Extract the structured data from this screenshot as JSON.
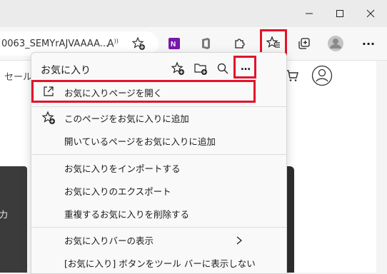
{
  "browser": {
    "address_text": "0063_SEMYrAJVAAAA...",
    "read_aloud_label": "A̅"
  },
  "page": {
    "left_text": "セール",
    "partial_text": "カ"
  },
  "favorites_panel": {
    "title": "お気に入り",
    "more_label": "…",
    "items": [
      {
        "label": "お気に入りページを開く"
      },
      {
        "label": "このページをお気に入りに追加"
      },
      {
        "label": "開いているページをお気に入りに追加"
      },
      {
        "label": "お気に入りをインポートする"
      },
      {
        "label": "お気に入りのエクスポート"
      },
      {
        "label": "重複するお気に入りを削除する"
      },
      {
        "label": "お気に入りバーの表示"
      },
      {
        "label": "[お気に入り] ボタンをツール バーに表示しない"
      }
    ]
  },
  "colors": {
    "highlight": "#e3122a",
    "onenote": "#7719aa",
    "office": "#7a7a7a"
  }
}
